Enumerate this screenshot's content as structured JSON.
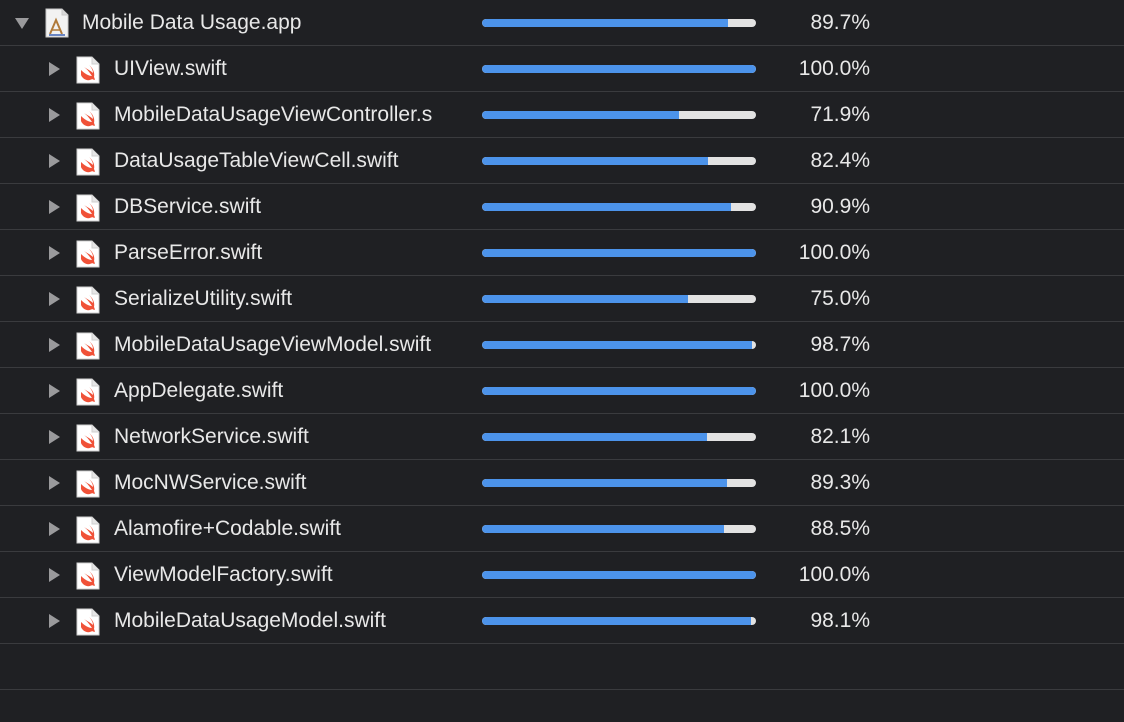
{
  "colors": {
    "background": "#1f2023",
    "divider": "#3a3b3e",
    "bar_fill": "#4c93ea",
    "bar_track": "#e2e2e2",
    "text": "#e8e8e8",
    "swift_orange": "#f05138"
  },
  "root": {
    "name": "Mobile Data Usage.app",
    "coverage_label": "89.7%",
    "coverage": 0.897,
    "expanded": true,
    "icon": "app-icon"
  },
  "files": [
    {
      "name": "UIView.swift",
      "coverage_label": "100.0%",
      "coverage": 1.0,
      "icon": "swift-file-icon"
    },
    {
      "name": "MobileDataUsageViewController.s",
      "coverage_label": "71.9%",
      "coverage": 0.719,
      "icon": "swift-file-icon"
    },
    {
      "name": "DataUsageTableViewCell.swift",
      "coverage_label": "82.4%",
      "coverage": 0.824,
      "icon": "swift-file-icon"
    },
    {
      "name": "DBService.swift",
      "coverage_label": "90.9%",
      "coverage": 0.909,
      "icon": "swift-file-icon"
    },
    {
      "name": "ParseError.swift",
      "coverage_label": "100.0%",
      "coverage": 1.0,
      "icon": "swift-file-icon"
    },
    {
      "name": "SerializeUtility.swift",
      "coverage_label": "75.0%",
      "coverage": 0.75,
      "icon": "swift-file-icon"
    },
    {
      "name": "MobileDataUsageViewModel.swift",
      "coverage_label": "98.7%",
      "coverage": 0.987,
      "icon": "swift-file-icon"
    },
    {
      "name": "AppDelegate.swift",
      "coverage_label": "100.0%",
      "coverage": 1.0,
      "icon": "swift-file-icon"
    },
    {
      "name": "NetworkService.swift",
      "coverage_label": "82.1%",
      "coverage": 0.821,
      "icon": "swift-file-icon"
    },
    {
      "name": "MocNWService.swift",
      "coverage_label": "89.3%",
      "coverage": 0.893,
      "icon": "swift-file-icon"
    },
    {
      "name": "Alamofire+Codable.swift",
      "coverage_label": "88.5%",
      "coverage": 0.885,
      "icon": "swift-file-icon"
    },
    {
      "name": "ViewModelFactory.swift",
      "coverage_label": "100.0%",
      "coverage": 1.0,
      "icon": "swift-file-icon"
    },
    {
      "name": "MobileDataUsageModel.swift",
      "coverage_label": "98.1%",
      "coverage": 0.981,
      "icon": "swift-file-icon"
    }
  ]
}
